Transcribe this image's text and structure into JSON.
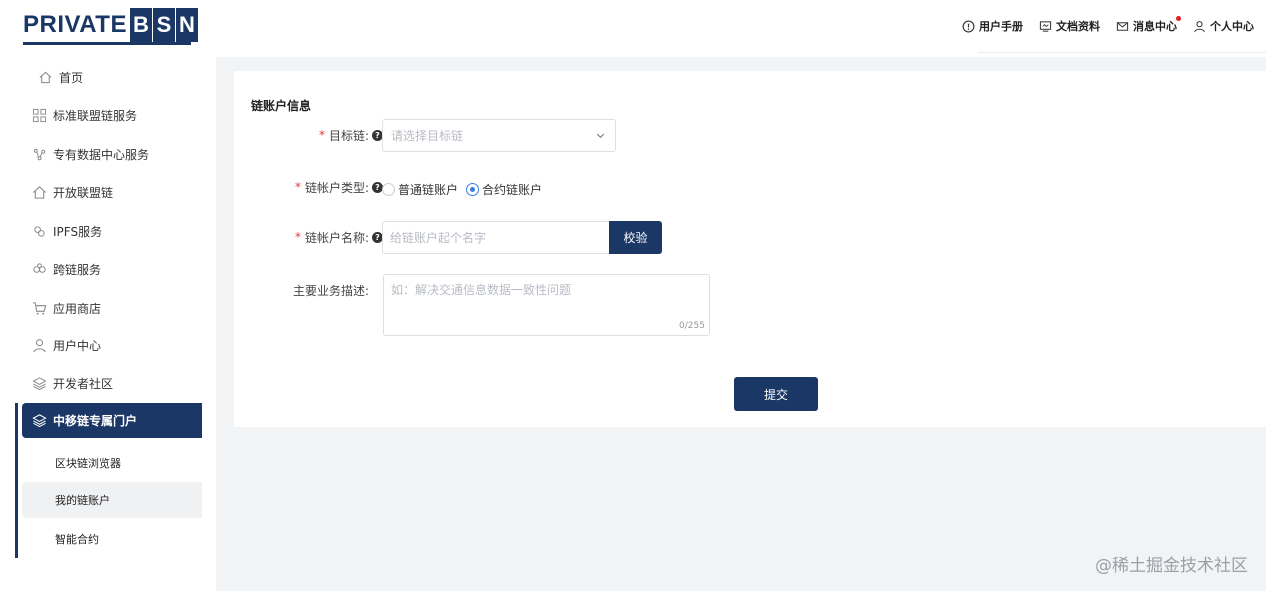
{
  "logo": {
    "text": "PRIVATE",
    "boxes": [
      "B",
      "S",
      "N"
    ]
  },
  "topnav": {
    "manual": "用户手册",
    "docs": "文档资料",
    "messages": "消息中心",
    "profile": "个人中心"
  },
  "sidebar": {
    "items": [
      {
        "label": "首页",
        "icon": "home-icon"
      },
      {
        "label": "标准联盟链服务",
        "icon": "grid-icon"
      },
      {
        "label": "专有数据中心服务",
        "icon": "nodes-icon"
      },
      {
        "label": "开放联盟链",
        "icon": "house-icon"
      },
      {
        "label": "IPFS服务",
        "icon": "ipfs-icon"
      },
      {
        "label": "跨链服务",
        "icon": "crosschain-icon"
      },
      {
        "label": "应用商店",
        "icon": "cart-icon"
      },
      {
        "label": "用户中心",
        "icon": "user-icon"
      },
      {
        "label": "开发者社区",
        "icon": "layers-icon"
      }
    ],
    "active": {
      "label": "中移链专属门户",
      "icon": "layers-icon"
    },
    "sub_items": [
      {
        "label": "区块链浏览器"
      },
      {
        "label": "我的链账户"
      },
      {
        "label": "智能合约"
      }
    ]
  },
  "form": {
    "section_title": "链账户信息",
    "target_chain": {
      "label": "目标链:",
      "placeholder": "请选择目标链"
    },
    "account_type": {
      "label": "链帐户类型:",
      "options": [
        "普通链账户",
        "合约链账户"
      ],
      "selected": "合约链账户"
    },
    "account_name": {
      "label": "链帐户名称:",
      "placeholder": "给链账户起个名字",
      "verify_label": "校验"
    },
    "description": {
      "label": "主要业务描述:",
      "placeholder": "如：解决交通信息数据一致性问题",
      "counter": "0/255"
    },
    "submit_label": "提交"
  },
  "watermark": "@稀土掘金技术社区",
  "colors": {
    "primary": "#1a3766",
    "required": "#e03c3c",
    "radio": "#3a7be0"
  }
}
